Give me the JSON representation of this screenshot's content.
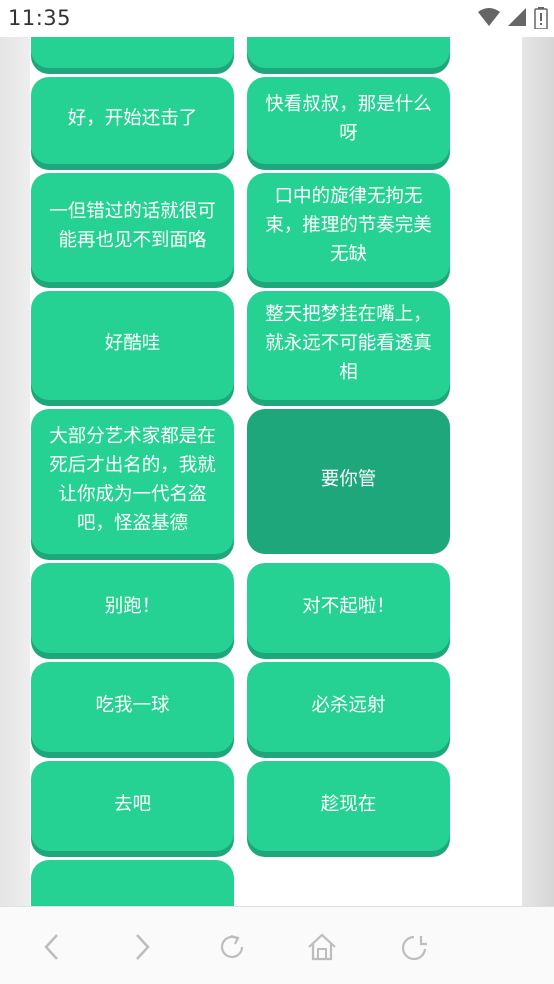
{
  "status": {
    "time": "11:35",
    "icons": [
      "wifi-icon",
      "signal-icon",
      "battery-icon"
    ]
  },
  "buttons": [
    {
      "label": ""
    },
    {
      "label": ""
    },
    {
      "label": "好，开始还击了"
    },
    {
      "label": "快看叔叔，那是什么呀"
    },
    {
      "label": "一但错过的话就很可能再也见不到面咯"
    },
    {
      "label": "口中的旋律无拘无束，推理的节奏完美无缺"
    },
    {
      "label": "好酷哇"
    },
    {
      "label": "整天把梦挂在嘴上，就永远不可能看透真相"
    },
    {
      "label": "大部分艺术家都是在死后才出名的，我就让你成为一代名盗吧，怪盗基德"
    },
    {
      "label": "要你管"
    },
    {
      "label": "别跑！"
    },
    {
      "label": "对不起啦！"
    },
    {
      "label": "吃我一球"
    },
    {
      "label": "必杀远射"
    },
    {
      "label": "去吧"
    },
    {
      "label": "趁现在"
    },
    {
      "label": ""
    }
  ],
  "nav": {
    "icons": [
      "back-icon",
      "forward-icon",
      "refresh-icon",
      "home-icon",
      "history-icon"
    ]
  },
  "colors": {
    "button": "#25d294",
    "button_shadow": "#1ea77a",
    "button_pressed": "#1ea77a"
  }
}
